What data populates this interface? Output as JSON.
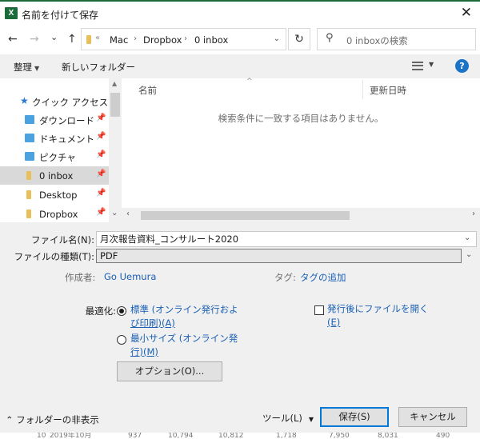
{
  "title_bar": {
    "app_icon_letter": "X",
    "title": "名前を付けて保存",
    "close_glyph": "✕"
  },
  "navigation": {
    "back": "←",
    "forward": "→",
    "recent": "⌄",
    "up": "↑"
  },
  "address_bar": {
    "separator": "«",
    "crumbs": [
      "Mac",
      "Dropbox",
      "0 inbox"
    ],
    "crumb_arrow": "›",
    "dropdown": "⌄",
    "refresh": "↻"
  },
  "search": {
    "placeholder": "0 inboxの検索",
    "icon": "⚲"
  },
  "toolbar": {
    "organize_label": "整理",
    "dropdown": "▼",
    "new_folder_label": "新しいフォルダー",
    "view_dropdown": "▼",
    "help_label": "?"
  },
  "nav_pane": {
    "quick_access_label": "クイック アクセス",
    "pin_glyph": "📌",
    "items": [
      {
        "label": "ダウンロード",
        "icon": "download-folder-icon"
      },
      {
        "label": "ドキュメント",
        "icon": "documents-folder-icon"
      },
      {
        "label": "ピクチャ",
        "icon": "pictures-folder-icon"
      },
      {
        "label": "0 inbox",
        "icon": "folder-icon",
        "selected": true
      },
      {
        "label": "Desktop",
        "icon": "folder-icon"
      },
      {
        "label": "Dropbox",
        "icon": "folder-icon"
      }
    ]
  },
  "file_list": {
    "columns": [
      "名前",
      "更新日時"
    ],
    "sort_indicator": "^",
    "empty_message": "検索条件に一致する項目はありません。"
  },
  "form": {
    "filename_label": "ファイル名(N):",
    "filename_value": "月次報告資料_コンサルート2020",
    "filetype_label": "ファイルの種類(T):",
    "filetype_value": "PDF",
    "author_label": "作成者:",
    "author_value": "Go Uemura",
    "tags_label": "タグ:",
    "tags_value": "タグの追加"
  },
  "optimize": {
    "label": "最適化:",
    "standard_line1": "標準 (オンライン発行およ",
    "standard_line2": "び印刷)(A)",
    "minimum_line1": "最小サイズ (オンライン発",
    "minimum_line2": "行)(M)",
    "selected": "standard",
    "options_button": "オプション(O)...",
    "open_after_line1": "発行後にファイルを開く",
    "open_after_line2": "(E)",
    "open_after_checked": false
  },
  "bottom": {
    "hide_folders_label": "フォルダーの非表示",
    "hide_folders_glyph": "⌃",
    "tools_label": "ツール(L)",
    "save_label": "保存(S)",
    "cancel_label": "キャンセル"
  },
  "background_strip": [
    "10",
    "2019年10月",
    "937",
    "10,794",
    "10,812",
    "1,718",
    "7,950",
    "8,031",
    "490"
  ]
}
